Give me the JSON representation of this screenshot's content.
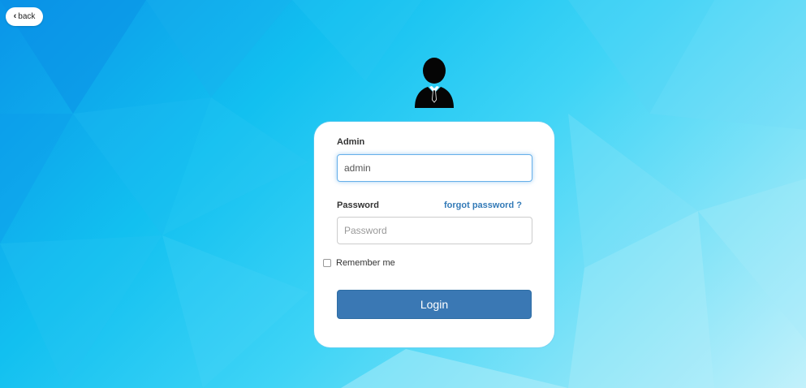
{
  "back_button": {
    "label": "back",
    "icon": "chevron-left-icon"
  },
  "avatar": {
    "icon": "user-suit-icon"
  },
  "login_form": {
    "username_label": "Admin",
    "username_value": "admin",
    "password_label": "Password",
    "password_placeholder": "Password",
    "forgot_password_link": "forgot password ?",
    "remember_me_label": "Remember me",
    "remember_me_checked": false,
    "login_button_label": "Login"
  },
  "colors": {
    "background_start": "#0a94e8",
    "background_end": "#c2f1fb",
    "primary_button": "#3a78b4",
    "link": "#337ab7",
    "focus_border": "#66afe9"
  }
}
